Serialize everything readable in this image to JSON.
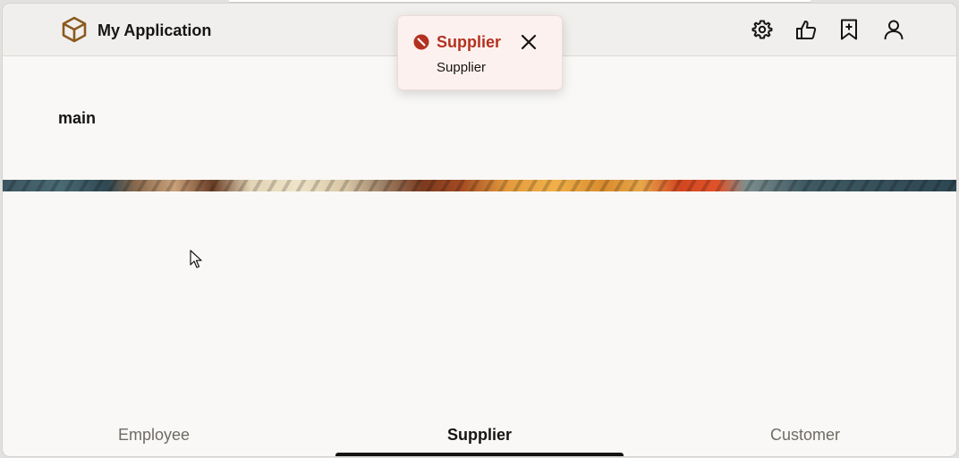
{
  "header": {
    "app_title": "My Application",
    "logo_icon": "cube-icon",
    "actions": [
      {
        "icon": "gear-icon"
      },
      {
        "icon": "thumbs-up-icon"
      },
      {
        "icon": "bookmark-add-icon"
      },
      {
        "icon": "user-icon"
      }
    ]
  },
  "main": {
    "heading": "main"
  },
  "tabs": [
    {
      "label": "Employee",
      "selected": false
    },
    {
      "label": "Supplier",
      "selected": true
    },
    {
      "label": "Customer",
      "selected": false
    }
  ],
  "toast": {
    "title": "Supplier",
    "message": "Supplier",
    "severity": "error",
    "icon": "error-icon",
    "close_icon": "close-icon"
  },
  "colors": {
    "accent": "#b3321f",
    "logo": "#8a5a1e",
    "text": "#161513",
    "muted": "#6f6b66"
  }
}
